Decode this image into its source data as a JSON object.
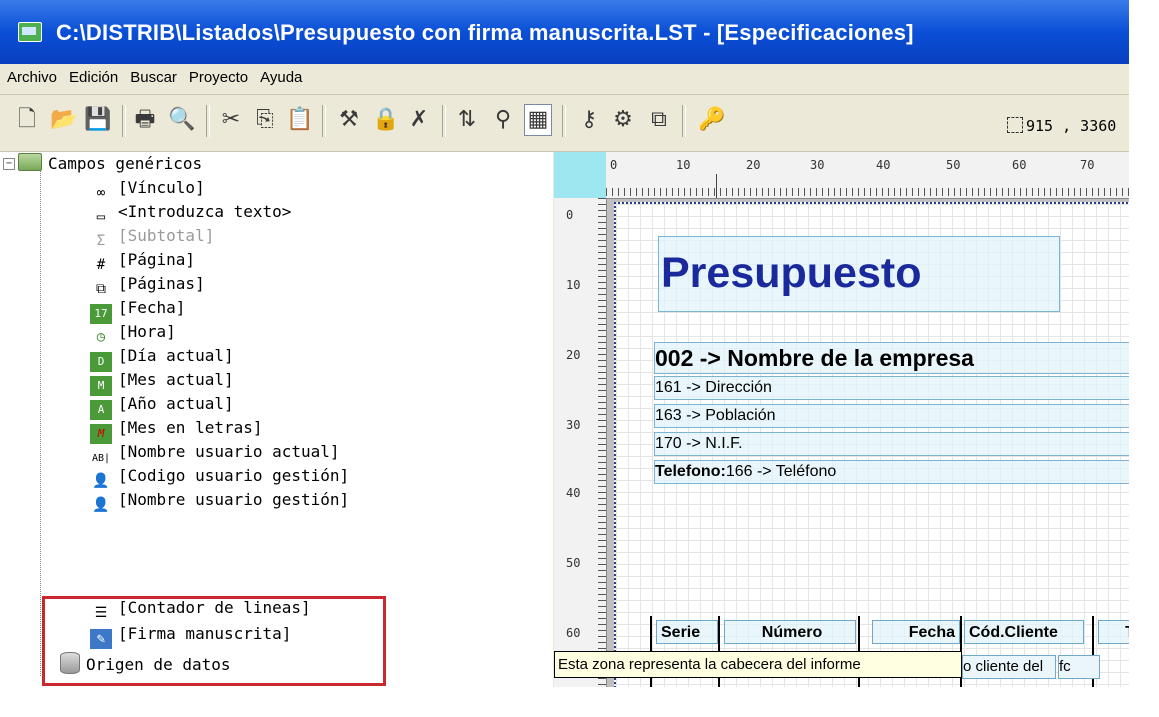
{
  "window": {
    "title": "C:\\DISTRIB\\Listados\\Presupuesto con firma manuscrita.LST - [Especificaciones]"
  },
  "menu": [
    "Archivo",
    "Edición",
    "Buscar",
    "Proyecto",
    "Ayuda"
  ],
  "toolbar": {
    "icons": [
      "new-icon",
      "open-icon",
      "save-icon",
      "print-icon",
      "print-preview-icon",
      "cut-icon",
      "copy-icon",
      "paste-icon",
      "tools-icon",
      "lock-icon",
      "delete-icon",
      "sort-az-icon",
      "filter-icon",
      "properties-icon",
      "key-icon",
      "gear-icon",
      "copy-format-icon",
      "search-key-icon"
    ],
    "coordinates": "915 , 3360"
  },
  "tree": {
    "root": "Campos  genéricos",
    "items": [
      {
        "label": "[Vínculo]",
        "icon": "link-icon"
      },
      {
        "label": "<Introduzca texto>",
        "icon": "textbox-icon"
      },
      {
        "label": "[Subtotal]",
        "icon": "sigma-icon",
        "disabled": true
      },
      {
        "label": "[Página]",
        "icon": "page-number-icon"
      },
      {
        "label": "[Páginas]",
        "icon": "pages-count-icon"
      },
      {
        "label": "[Fecha]",
        "icon": "date-icon"
      },
      {
        "label": "[Hora]",
        "icon": "clock-icon"
      },
      {
        "label": "[Día actual]",
        "icon": "day-icon"
      },
      {
        "label": "[Mes actual]",
        "icon": "month-icon"
      },
      {
        "label": "[Año actual]",
        "icon": "year-icon"
      },
      {
        "label": "[Mes en letras]",
        "icon": "month-letters-icon"
      },
      {
        "label": "[Nombre usuario actual]",
        "icon": "current-user-icon"
      },
      {
        "label": "[Codigo usuario gestión]",
        "icon": "user-code-icon"
      },
      {
        "label": "[Nombre usuario gestión]",
        "icon": "user-name-icon"
      },
      {
        "label": "[Contador de lineas]",
        "icon": "line-counter-icon"
      },
      {
        "label": "[Firma manuscrita]",
        "icon": "signature-icon"
      }
    ],
    "datasource": "Origen de datos"
  },
  "ruler": {
    "h_labels": [
      "0",
      "10",
      "20",
      "30",
      "40",
      "50",
      "60",
      "70"
    ],
    "v_labels": [
      "0",
      "10",
      "20",
      "30",
      "40",
      "50",
      "60"
    ]
  },
  "report": {
    "title": "Presupuesto",
    "company": "002 -> Nombre de la empresa",
    "address": "161 -> Dirección",
    "city": "163 -> Población",
    "nif": "170 -> N.I.F.",
    "phone_label": "Telefono:",
    "phone_value": "166 -> Teléfono",
    "table_headers": [
      "Serie",
      "Número",
      "Fecha",
      "Cód.Cliente",
      "T"
    ],
    "row_fragments": [
      "o cliente del",
      "fc"
    ]
  },
  "tooltip": "Esta zona representa la cabecera del informe",
  "colors": {
    "title_blue": "#1a2a9c",
    "highlight_red": "#c8282e",
    "corner_cyan": "#9ee6f0"
  }
}
